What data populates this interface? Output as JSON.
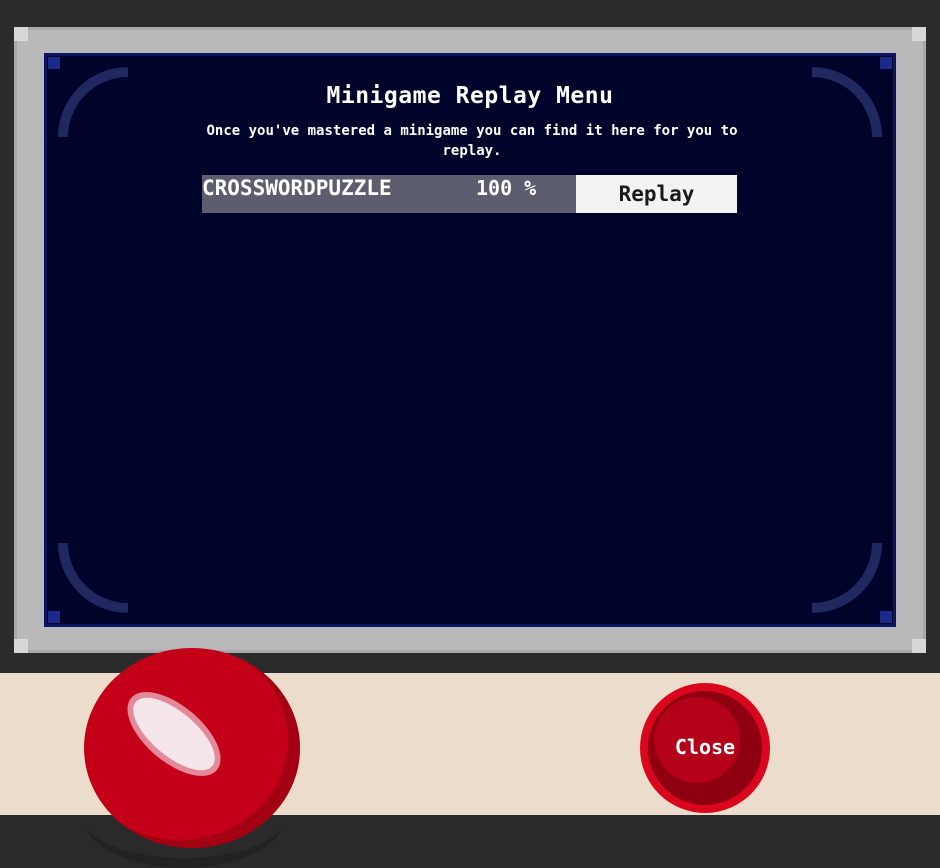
{
  "menu": {
    "title": "Minigame Replay Menu",
    "description": "Once you've mastered a minigame you can find it here for you to replay."
  },
  "games": [
    {
      "name": "CROSSWORDPUZZLE",
      "progress": "100 %",
      "action_label": "Replay"
    }
  ],
  "controls": {
    "close_label": "Close"
  },
  "colors": {
    "screen_background": "#00042a",
    "frame": "#b9b9b9",
    "console_body": "#ecdccb",
    "button_red": "#c40018"
  }
}
